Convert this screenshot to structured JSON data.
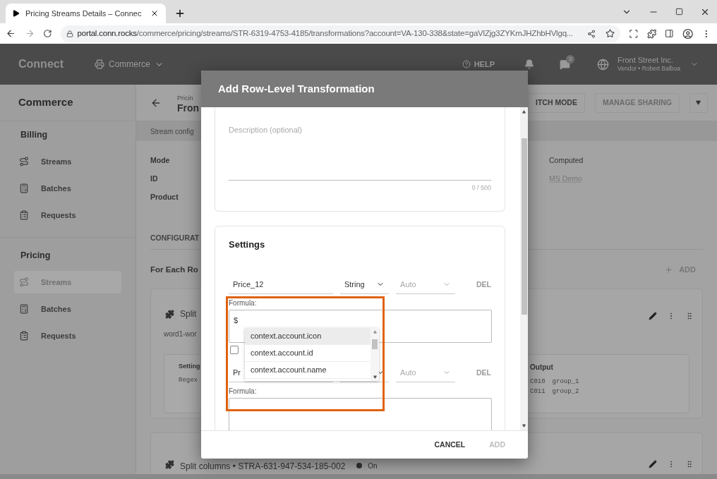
{
  "browser": {
    "tab": {
      "title": "Pricing Streams Details – Connec"
    },
    "address": {
      "host": "portal.conn.rocks",
      "path": "/commerce/pricing/streams/STR-6319-4753-4185/transformations?account=VA-130-338&state=gaVlZjg3ZYKmJHZhbHVlgq..."
    }
  },
  "app_header": {
    "logo": "Connect",
    "module": "Commerce",
    "help": "HELP",
    "notifications_count": "3",
    "account": {
      "name": "Front Street Inc.",
      "role": "Vendor • Robert Balboa"
    }
  },
  "sidebar": {
    "title": "Commerce",
    "sections": [
      {
        "title": "Billing",
        "items": [
          {
            "label": "Streams",
            "kind": "streams",
            "selected": false
          },
          {
            "label": "Batches",
            "kind": "batches",
            "selected": false
          },
          {
            "label": "Requests",
            "kind": "requests",
            "selected": false
          }
        ]
      },
      {
        "title": "Pricing",
        "items": [
          {
            "label": "Streams",
            "kind": "streams",
            "selected": true
          },
          {
            "label": "Batches",
            "kind": "batches",
            "selected": false
          },
          {
            "label": "Requests",
            "kind": "requests",
            "selected": false
          }
        ]
      }
    ]
  },
  "page": {
    "breadcrumb": "Pricin",
    "title": "Fron",
    "actions": [
      {
        "label": "ITCH MODE",
        "disabled": false
      },
      {
        "label": "MANAGE SHARING",
        "disabled": true
      }
    ],
    "tab": "Stream config",
    "details": {
      "labels": [
        "Mode",
        "ID",
        "Product"
      ],
      "values": [
        {
          "text": "Computed",
          "kind": "plain"
        },
        {
          "text": "MS Demo",
          "kind": "link"
        }
      ]
    },
    "section_tab": "CONFIGURAT",
    "section_title": "For Each Ro",
    "add": "ADD",
    "card": {
      "title": "Split",
      "subtitle": "word1-wor",
      "settings_title": "Setting",
      "settings_value": "Regex",
      "output_title": "Output",
      "output_rows": [
        [
          "C010",
          "group_1"
        ],
        [
          "C011",
          "group_2"
        ]
      ]
    },
    "card2": {
      "title": "Split columns • STRA-631-947-534-185-002",
      "status": "On"
    }
  },
  "modal": {
    "title": "Add Row-Level Transformation",
    "description": {
      "placeholder": "Description (optional)",
      "counter": "0 / 500"
    },
    "settings": {
      "title": "Settings",
      "rows": [
        {
          "name": "Price_12",
          "type": "String",
          "precision": "Auto",
          "delete": "DEL",
          "formula_label": "Formula:",
          "formula": "$",
          "checked": false
        },
        {
          "name": "Pr",
          "precision": "Auto",
          "delete": "DEL",
          "formula_label": "Formula:"
        }
      ]
    },
    "autocomplete": {
      "options": [
        {
          "text": "context.account.icon",
          "selected": true
        },
        {
          "text": "context.account.id",
          "selected": false
        },
        {
          "text": "context.account.name",
          "selected": false
        }
      ]
    },
    "footer": {
      "cancel": "CANCEL",
      "add": {
        "label": "ADD",
        "disabled": true
      }
    }
  }
}
